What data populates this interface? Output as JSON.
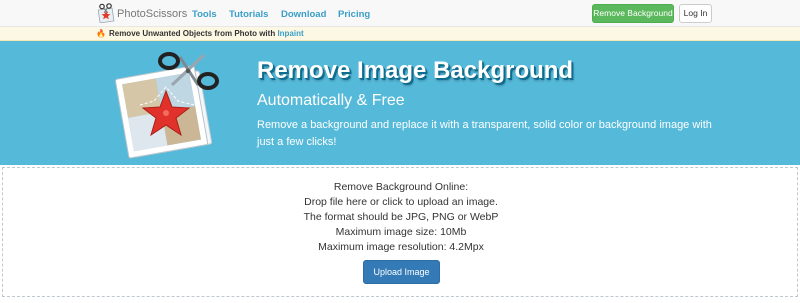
{
  "nav": {
    "brand": "PhotoScissors",
    "links": [
      "Tools",
      "Tutorials",
      "Download",
      "Pricing"
    ],
    "remove_button": "Remove Background",
    "login_button": "Log In"
  },
  "promo": {
    "text": "Remove Unwanted Objects from Photo with ",
    "link": "Inpaint",
    "icon": "flame-icon"
  },
  "hero": {
    "title": "Remove Image Background",
    "subtitle": "Automatically & Free",
    "description": "Remove a background and replace it with a transparent, solid color or background image with just a few clicks!",
    "art_icon": "scissors-starfish-photo-icon"
  },
  "dropzone": {
    "heading": "Remove Background Online:",
    "lines": [
      "Drop file here or click to upload an image.",
      "The format should be JPG, PNG or WebP",
      "Maximum image size: 10Mb",
      "Maximum image resolution: 4.2Mpx"
    ],
    "upload_button": "Upload Image"
  },
  "colors": {
    "hero_bg": "#55b9d9",
    "nav_link": "#3a9fc8",
    "remove_button": "#5cb85c",
    "upload_button": "#337ab7",
    "promo_bg": "#fcf8e3"
  }
}
